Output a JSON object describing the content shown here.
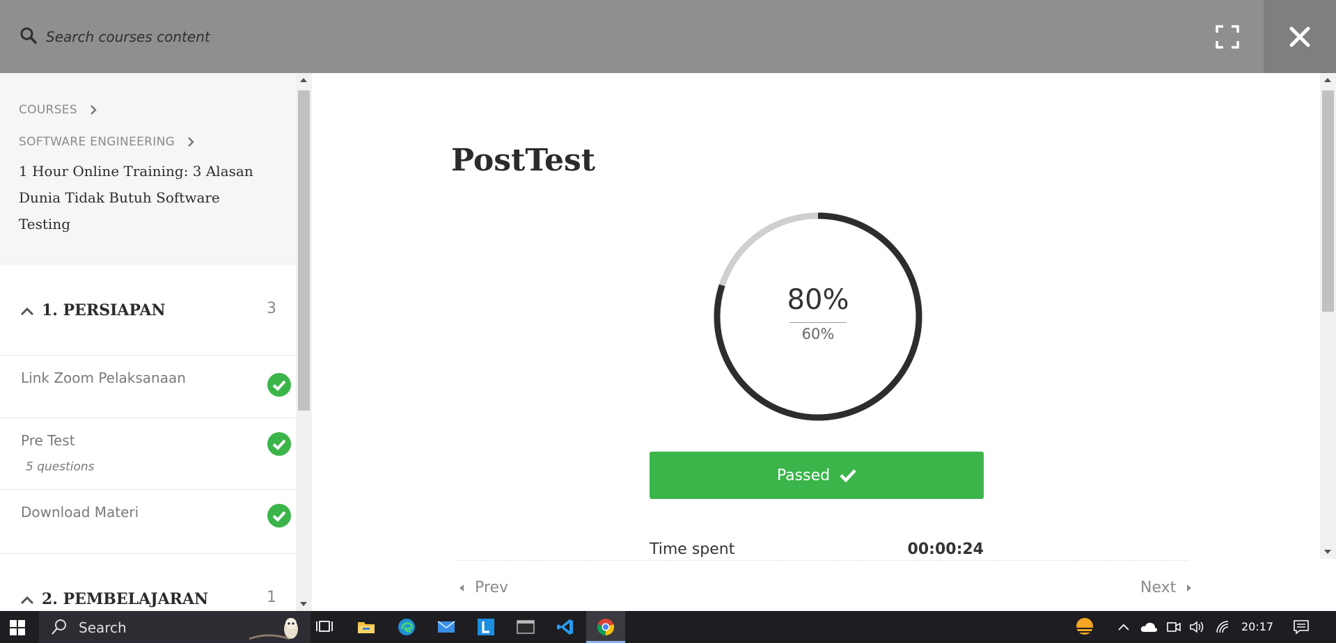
{
  "header": {
    "search_placeholder": "Search courses content",
    "expand_icon": "fullscreen-icon",
    "close_icon": "close-icon"
  },
  "sidebar": {
    "breadcrumbs": [
      "COURSES",
      "SOFTWARE ENGINEERING"
    ],
    "course_title": "1 Hour Online Training: 3 Alasan Dunia Tidak Butuh Software Testing",
    "sections": [
      {
        "title": "1. PERSIAPAN",
        "count": "3",
        "items": [
          {
            "label": "Link Zoom Pelaksanaan",
            "sub": "",
            "status": "completed"
          },
          {
            "label": "Pre Test",
            "sub": "5 questions",
            "status": "completed"
          },
          {
            "label": "Download Materi",
            "sub": "",
            "status": "completed"
          }
        ]
      },
      {
        "title": "2. PEMBELAJARAN",
        "count": "1",
        "items": []
      }
    ]
  },
  "main": {
    "quiz_title": "PostTest",
    "result": {
      "score": "80%",
      "passing_grade": "60%",
      "score_fraction": 0.8
    },
    "status_label": "Passed",
    "time_spent_label": "Time spent",
    "time_spent_value": "00:00:24",
    "prev_label": "Prev",
    "next_label": "Next"
  },
  "taskbar": {
    "search_label": "Search",
    "clock": "20:17"
  },
  "colors": {
    "topbar": "#8f8f8f",
    "success": "#3bb54a",
    "ring_dark": "#2d2d2d",
    "ring_light": "#cfcfcf"
  }
}
